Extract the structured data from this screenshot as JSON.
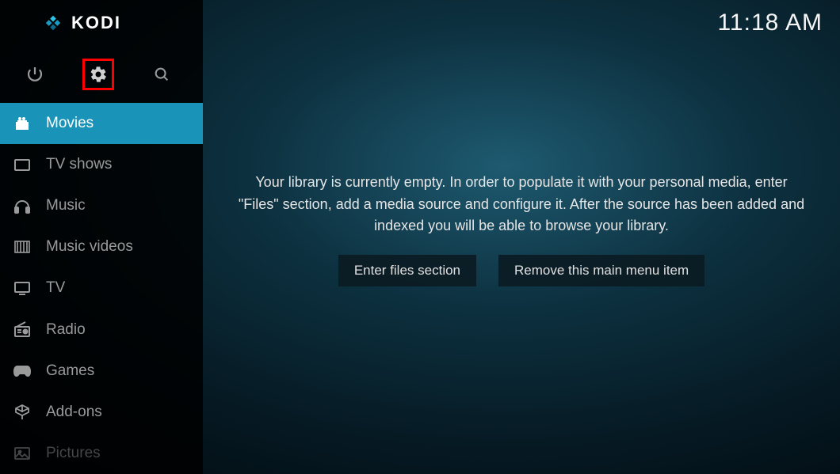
{
  "clock": "11:18 AM",
  "brand": {
    "name": "KODI"
  },
  "toolbar": {
    "power": "power-icon",
    "settings": "gear-icon",
    "search": "search-icon"
  },
  "sidebar": {
    "items": [
      {
        "label": "Movies",
        "icon": "movie-icon",
        "active": true
      },
      {
        "label": "TV shows",
        "icon": "tvshows-icon",
        "active": false
      },
      {
        "label": "Music",
        "icon": "music-icon",
        "active": false
      },
      {
        "label": "Music videos",
        "icon": "musicvid-icon",
        "active": false
      },
      {
        "label": "TV",
        "icon": "tv-icon",
        "active": false
      },
      {
        "label": "Radio",
        "icon": "radio-icon",
        "active": false
      },
      {
        "label": "Games",
        "icon": "games-icon",
        "active": false
      },
      {
        "label": "Add-ons",
        "icon": "addons-icon",
        "active": false
      },
      {
        "label": "Pictures",
        "icon": "pictures-icon",
        "active": false,
        "faded": true
      }
    ]
  },
  "content": {
    "empty_message": "Your library is currently empty. In order to populate it with your personal media, enter \"Files\" section, add a media source and configure it. After the source has been added and indexed you will be able to browse your library.",
    "buttons": {
      "enter_files": "Enter files section",
      "remove_menu": "Remove this main menu item"
    }
  }
}
